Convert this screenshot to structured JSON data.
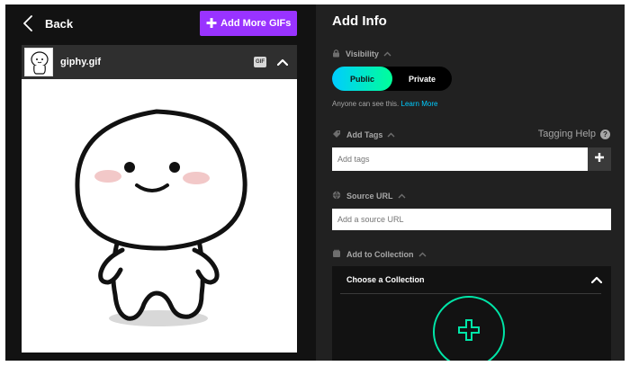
{
  "left": {
    "back_label": "Back",
    "add_more_label": "Add More GIFs",
    "gif": {
      "file_name": "giphy.gif",
      "badge": "GIF"
    }
  },
  "right": {
    "title": "Add Info",
    "visibility": {
      "label": "Visibility",
      "options": [
        "Public",
        "Private"
      ],
      "selected": "Public",
      "note": "Anyone can see this.",
      "learn_more": "Learn More"
    },
    "tags": {
      "label": "Add Tags",
      "help": "Tagging Help",
      "help_glyph": "?",
      "placeholder": "Add tags"
    },
    "source": {
      "label": "Source URL",
      "placeholder": "Add a source URL"
    },
    "collection": {
      "label": "Add to Collection",
      "choose_label": "Choose a Collection"
    }
  },
  "colors": {
    "accent_purple": "#9933ff",
    "toggle_gradient_start": "#00ccff",
    "toggle_gradient_end": "#00ff99",
    "link": "#00ccff",
    "collection_ring": "#00e6a8",
    "panel_dark": "#121212",
    "panel_right": "#212121"
  },
  "icons": [
    "chevron-left-icon",
    "plus-icon",
    "gif-badge",
    "chevron-up-icon",
    "lock-icon",
    "tag-icon",
    "globe-icon",
    "collection-icon",
    "help-icon"
  ]
}
